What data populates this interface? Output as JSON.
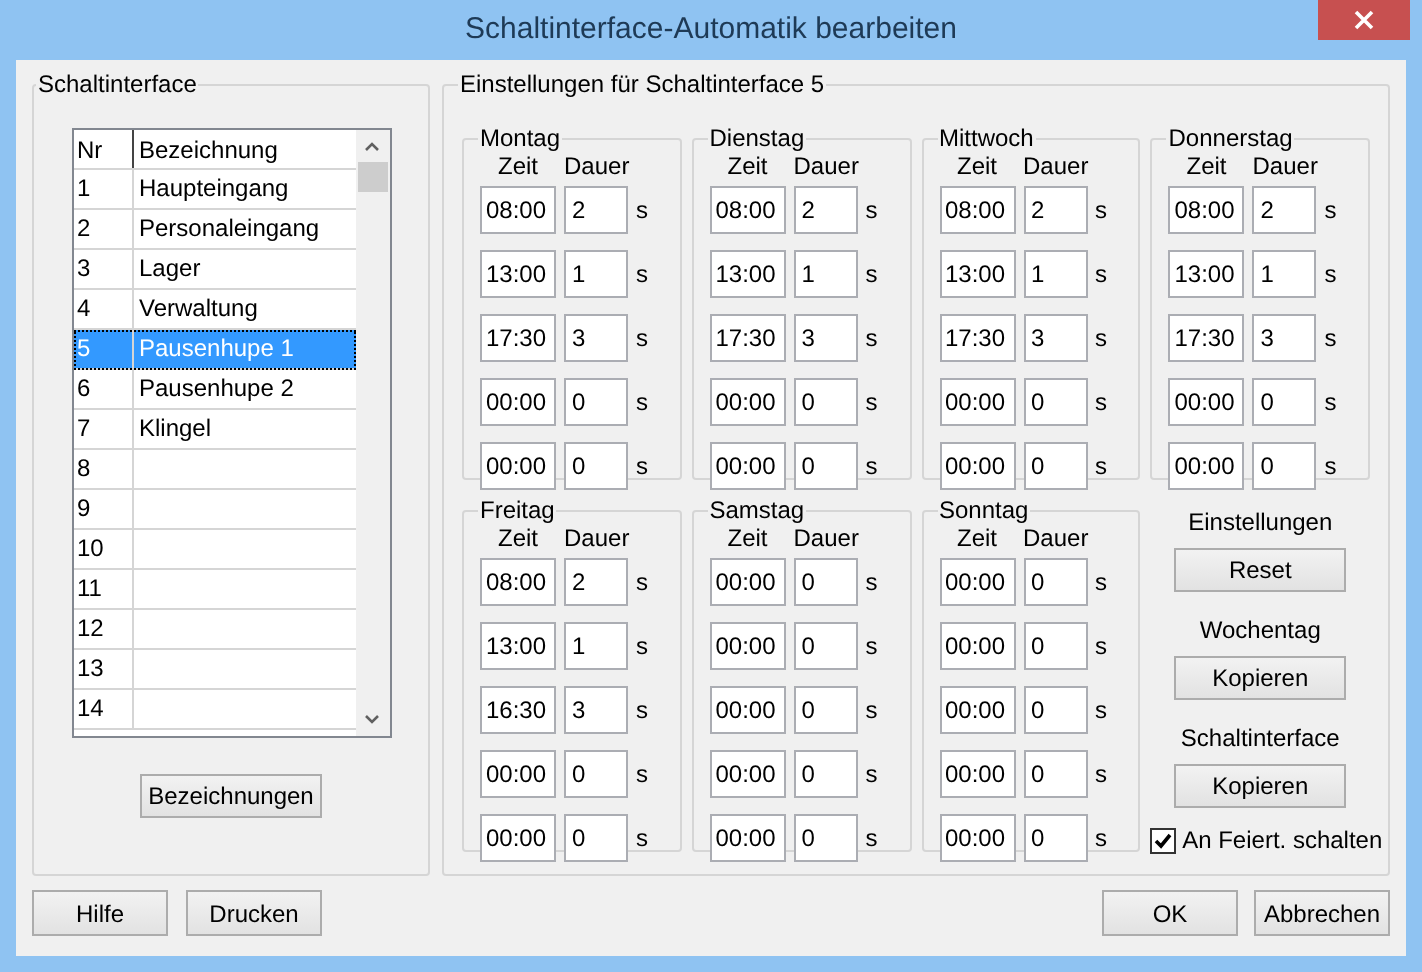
{
  "window": {
    "title": "Schaltinterface-Automatik bearbeiten"
  },
  "left_panel": {
    "title": "Schaltinterface",
    "columns": [
      "Nr",
      "Bezeichnung"
    ],
    "rows": [
      {
        "nr": "1",
        "name": "Haupteingang",
        "selected": false
      },
      {
        "nr": "2",
        "name": "Personaleingang",
        "selected": false
      },
      {
        "nr": "3",
        "name": "Lager",
        "selected": false
      },
      {
        "nr": "4",
        "name": "Verwaltung",
        "selected": false
      },
      {
        "nr": "5",
        "name": "Pausenhupe 1",
        "selected": true
      },
      {
        "nr": "6",
        "name": "Pausenhupe 2",
        "selected": false
      },
      {
        "nr": "7",
        "name": "Klingel",
        "selected": false
      },
      {
        "nr": "8",
        "name": "",
        "selected": false
      },
      {
        "nr": "9",
        "name": "",
        "selected": false
      },
      {
        "nr": "10",
        "name": "",
        "selected": false
      },
      {
        "nr": "11",
        "name": "",
        "selected": false
      },
      {
        "nr": "12",
        "name": "",
        "selected": false
      },
      {
        "nr": "13",
        "name": "",
        "selected": false
      },
      {
        "nr": "14",
        "name": "",
        "selected": false
      }
    ],
    "button": "Bezeichnungen"
  },
  "right_panel": {
    "title": "Einstellungen für Schaltinterface 5",
    "days": [
      {
        "name": "Montag",
        "time_label": "Zeit",
        "duration_label": "Dauer",
        "slots": [
          {
            "time": "08:00",
            "duration": "2",
            "unit": "s"
          },
          {
            "time": "13:00",
            "duration": "1",
            "unit": "s"
          },
          {
            "time": "17:30",
            "duration": "3",
            "unit": "s"
          },
          {
            "time": "00:00",
            "duration": "0",
            "unit": "s"
          },
          {
            "time": "00:00",
            "duration": "0",
            "unit": "s"
          }
        ]
      },
      {
        "name": "Dienstag",
        "time_label": "Zeit",
        "duration_label": "Dauer",
        "slots": [
          {
            "time": "08:00",
            "duration": "2",
            "unit": "s"
          },
          {
            "time": "13:00",
            "duration": "1",
            "unit": "s"
          },
          {
            "time": "17:30",
            "duration": "3",
            "unit": "s"
          },
          {
            "time": "00:00",
            "duration": "0",
            "unit": "s"
          },
          {
            "time": "00:00",
            "duration": "0",
            "unit": "s"
          }
        ]
      },
      {
        "name": "Mittwoch",
        "time_label": "Zeit",
        "duration_label": "Dauer",
        "slots": [
          {
            "time": "08:00",
            "duration": "2",
            "unit": "s"
          },
          {
            "time": "13:00",
            "duration": "1",
            "unit": "s"
          },
          {
            "time": "17:30",
            "duration": "3",
            "unit": "s"
          },
          {
            "time": "00:00",
            "duration": "0",
            "unit": "s"
          },
          {
            "time": "00:00",
            "duration": "0",
            "unit": "s"
          }
        ]
      },
      {
        "name": "Donnerstag",
        "time_label": "Zeit",
        "duration_label": "Dauer",
        "slots": [
          {
            "time": "08:00",
            "duration": "2",
            "unit": "s"
          },
          {
            "time": "13:00",
            "duration": "1",
            "unit": "s"
          },
          {
            "time": "17:30",
            "duration": "3",
            "unit": "s"
          },
          {
            "time": "00:00",
            "duration": "0",
            "unit": "s"
          },
          {
            "time": "00:00",
            "duration": "0",
            "unit": "s"
          }
        ]
      },
      {
        "name": "Freitag",
        "time_label": "Zeit",
        "duration_label": "Dauer",
        "slots": [
          {
            "time": "08:00",
            "duration": "2",
            "unit": "s"
          },
          {
            "time": "13:00",
            "duration": "1",
            "unit": "s"
          },
          {
            "time": "16:30",
            "duration": "3",
            "unit": "s"
          },
          {
            "time": "00:00",
            "duration": "0",
            "unit": "s"
          },
          {
            "time": "00:00",
            "duration": "0",
            "unit": "s"
          }
        ]
      },
      {
        "name": "Samstag",
        "time_label": "Zeit",
        "duration_label": "Dauer",
        "slots": [
          {
            "time": "00:00",
            "duration": "0",
            "unit": "s"
          },
          {
            "time": "00:00",
            "duration": "0",
            "unit": "s"
          },
          {
            "time": "00:00",
            "duration": "0",
            "unit": "s"
          },
          {
            "time": "00:00",
            "duration": "0",
            "unit": "s"
          },
          {
            "time": "00:00",
            "duration": "0",
            "unit": "s"
          }
        ]
      },
      {
        "name": "Sonntag",
        "time_label": "Zeit",
        "duration_label": "Dauer",
        "slots": [
          {
            "time": "00:00",
            "duration": "0",
            "unit": "s"
          },
          {
            "time": "00:00",
            "duration": "0",
            "unit": "s"
          },
          {
            "time": "00:00",
            "duration": "0",
            "unit": "s"
          },
          {
            "time": "00:00",
            "duration": "0",
            "unit": "s"
          },
          {
            "time": "00:00",
            "duration": "0",
            "unit": "s"
          }
        ]
      }
    ],
    "actions": [
      {
        "label": "Einstellungen",
        "button": "Reset"
      },
      {
        "label": "Wochentag",
        "button": "Kopieren"
      },
      {
        "label": "Schaltinterface",
        "button": "Kopieren"
      }
    ],
    "holiday": {
      "label": "An Feiert. schalten",
      "checked": true
    }
  },
  "buttons_left": [
    "Hilfe",
    "Drucken"
  ],
  "buttons_right": [
    "OK",
    "Abbrechen"
  ]
}
